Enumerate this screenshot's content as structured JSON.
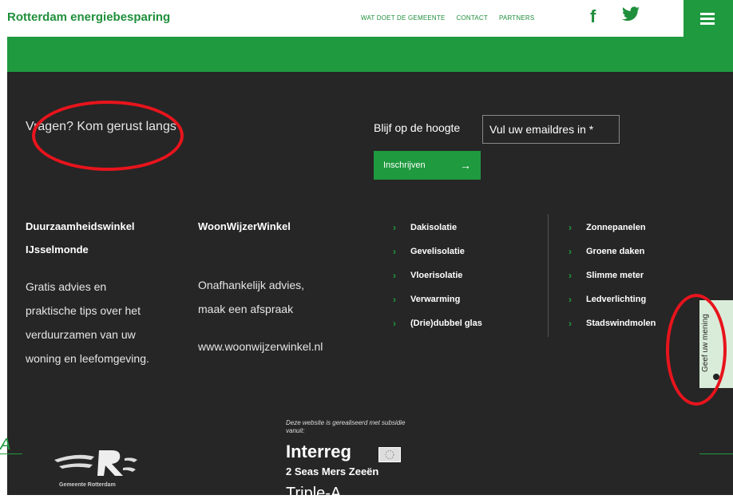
{
  "header": {
    "brand": "Rotterdam energiebesparing",
    "nav": [
      "WAT DOET DE GEMEENTE",
      "CONTACT",
      "PARTNERS"
    ],
    "social": [
      "facebook-icon",
      "twitter-icon"
    ],
    "menu_icon": "hamburger-icon"
  },
  "footer": {
    "question": "Vragen? Kom gerust langs",
    "newsletter": {
      "label": "Blijf op de hoogte",
      "email_placeholder": "Vul uw emaildres in *",
      "button": "Inschrijven",
      "button_icon": "→"
    },
    "col1": {
      "title1": "Duurzaamheidswinkel",
      "title2": "IJsselmonde",
      "lines": [
        "Gratis advies en",
        "praktische tips over het",
        "verduurzamen van uw",
        "woning en leefomgeving."
      ]
    },
    "col2": {
      "title": "WoonWijzerWinkel",
      "lines": [
        "Onafhankelijk advies,",
        "maak een afspraak"
      ],
      "link": "www.woonwijzerwinkel.nl"
    },
    "links_left": [
      "Dakisolatie",
      "Gevelisolatie",
      "Vloerisolatie",
      "Verwarming",
      "(Drie)dubbel glas"
    ],
    "links_right": [
      "Zonnepanelen",
      "Groene daken",
      "Slimme meter",
      "Ledverlichting",
      "Stadswindmolen"
    ],
    "logo_caption": "Gemeente Rotterdam",
    "subsidy_note": "Deze website is gerealiseerd met subsidie vanuit:",
    "interreg": "Interreg",
    "seas": "2 Seas Mers Zeeën",
    "triple": "Triple-A"
  },
  "feedback": {
    "label": "Geef uw mening"
  },
  "colors": {
    "brand_green": "#1f9a3f",
    "footer_bg": "#262626",
    "annotation_red": "#e8141c"
  }
}
